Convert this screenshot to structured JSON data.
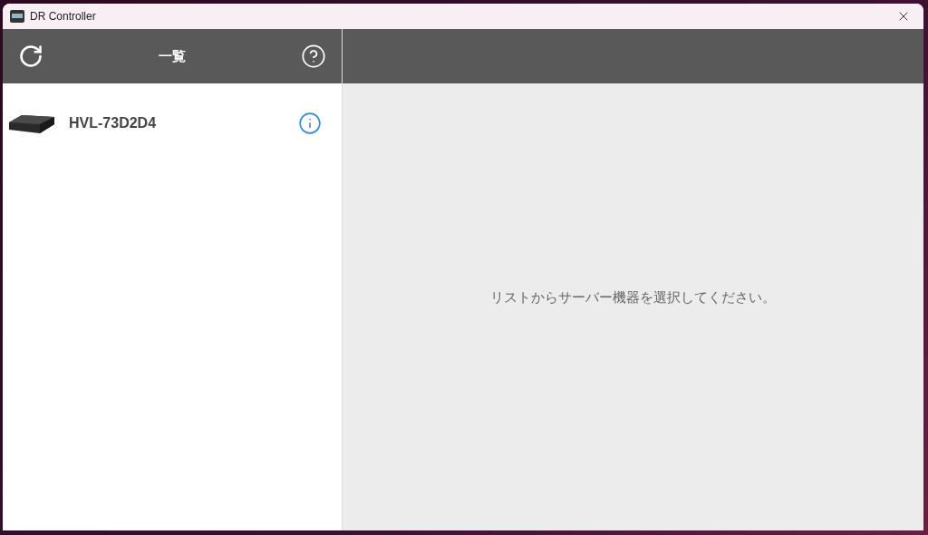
{
  "window": {
    "title": "DR Controller"
  },
  "list_panel": {
    "title": "一覧"
  },
  "devices": [
    {
      "name": "HVL-73D2D4",
      "selected": false
    }
  ],
  "detail_panel": {
    "message": "リストからサーバー機器を選択してください。"
  }
}
